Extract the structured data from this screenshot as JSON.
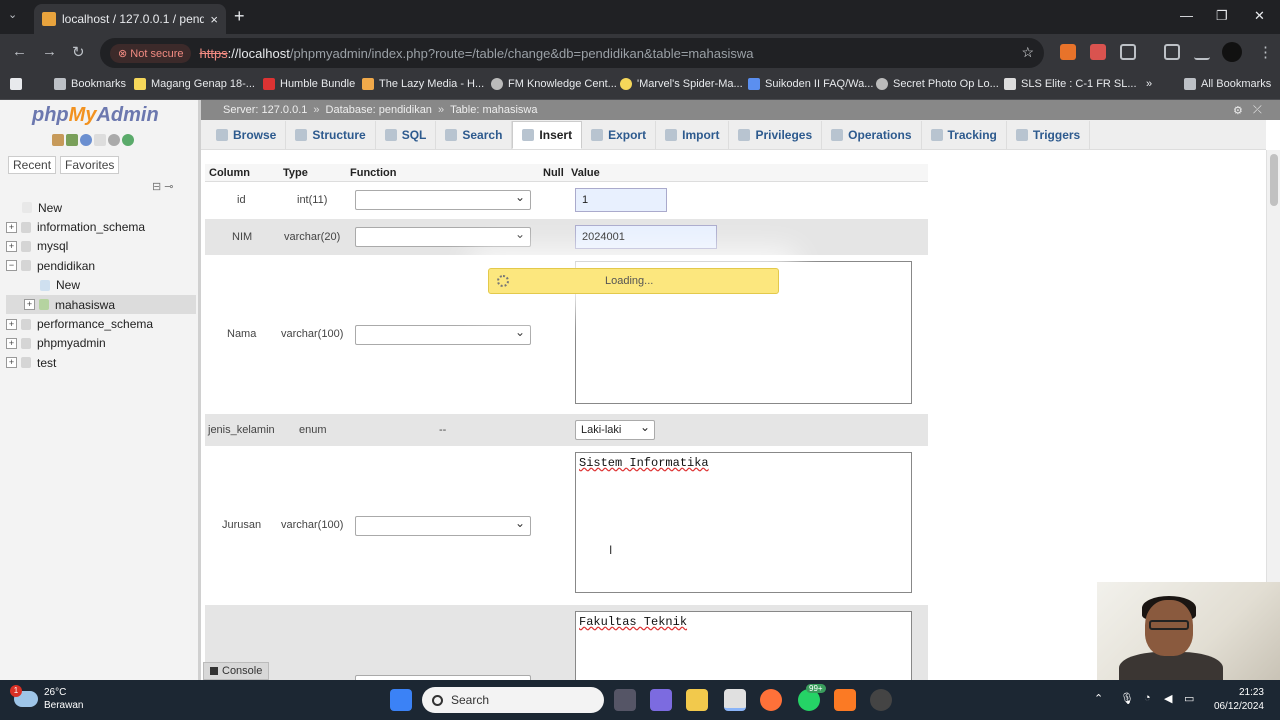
{
  "browser": {
    "tab_title": "localhost / 127.0.0.1 / pendidikan",
    "tab_close": "×",
    "new_tab": "+",
    "not_secure": "Not secure",
    "url_https": "https",
    "url_host": "://localhost",
    "url_path": "/phpmyadmin/index.php?route=/table/change&db=pendidikan&table=mahasiswa",
    "bookmarks": [
      {
        "label": "Bookmarks",
        "color": "#8ab4f8"
      },
      {
        "label": "Magang Genap 18-...",
        "color": "#f5d75a"
      },
      {
        "label": "Humble Bundle",
        "color": "#d33"
      },
      {
        "label": "The Lazy Media - H...",
        "color": "#f0a94a"
      },
      {
        "label": "FM Knowledge Cent...",
        "color": "#bbb"
      },
      {
        "label": "'Marvel's Spider-Ma...",
        "color": "#f5d75a"
      },
      {
        "label": "Suikoden II FAQ/Wa...",
        "color": "#5b8ff0"
      },
      {
        "label": "Secret Photo Op Lo...",
        "color": "#bbb"
      },
      {
        "label": "SLS Elite : C-1 FR SL...",
        "color": "#ddd"
      }
    ],
    "more_bookmarks": "»",
    "all_bookmarks": "All Bookmarks"
  },
  "pma": {
    "logo_php": "php",
    "logo_my": "My",
    "logo_admin": "Admin",
    "sidebar_tabs": [
      "Recent",
      "Favorites"
    ],
    "tree": [
      {
        "label": "New",
        "indent": 1,
        "expander": ""
      },
      {
        "label": "information_schema",
        "indent": 0,
        "expander": "+"
      },
      {
        "label": "mysql",
        "indent": 0,
        "expander": "+"
      },
      {
        "label": "pendidikan",
        "indent": 0,
        "expander": "−"
      },
      {
        "label": "New",
        "indent": 2,
        "expander": ""
      },
      {
        "label": "mahasiswa",
        "indent": 1,
        "expander": "+",
        "selected": true
      },
      {
        "label": "performance_schema",
        "indent": 0,
        "expander": "+"
      },
      {
        "label": "phpmyadmin",
        "indent": 0,
        "expander": "+"
      },
      {
        "label": "test",
        "indent": 0,
        "expander": "+"
      }
    ],
    "breadcrumb": {
      "server": "Server: 127.0.0.1",
      "database": "Database: pendidikan",
      "table": "Table: mahasiswa",
      "sep": "»"
    },
    "menu_tabs": [
      "Browse",
      "Structure",
      "SQL",
      "Search",
      "Insert",
      "Export",
      "Import",
      "Privileges",
      "Operations",
      "Tracking",
      "Triggers"
    ],
    "active_tab": "Insert",
    "columns_header": {
      "column": "Column",
      "type": "Type",
      "function": "Function",
      "null": "Null",
      "value": "Value"
    },
    "fields": {
      "id": {
        "name": "id",
        "type": "int(11)",
        "value": "1"
      },
      "nim": {
        "name": "NIM",
        "type": "varchar(20)",
        "value": "2024001"
      },
      "nama": {
        "name": "Nama",
        "type": "varchar(100)",
        "value": ""
      },
      "jk": {
        "name": "jenis_kelamin",
        "type": "enum",
        "function": "--",
        "value": "Laki-laki"
      },
      "jurusan": {
        "name": "Jurusan",
        "type": "varchar(100)",
        "value": "Sistem Informatika"
      },
      "fakultas": {
        "value": "Fakultas Teknik"
      }
    },
    "loading": "Loading...",
    "console": "Console"
  },
  "taskbar": {
    "temp": "26°C",
    "weather": "Berawan",
    "weather_badge": "1",
    "search": "Search",
    "whatsapp_badge": "99+",
    "time": "21:23",
    "date": "06/12/2024"
  }
}
